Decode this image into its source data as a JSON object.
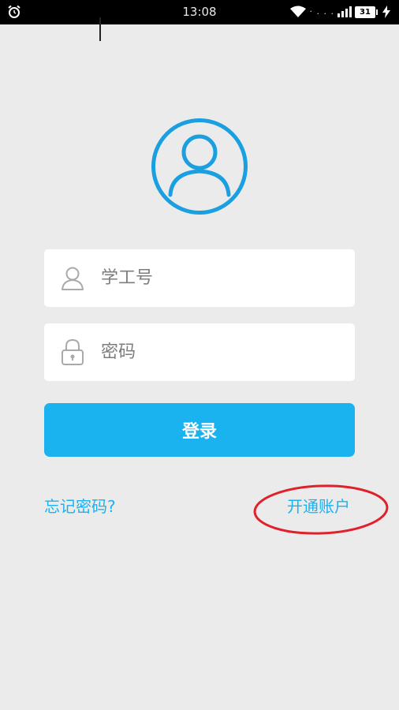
{
  "status_bar": {
    "time": "13:08",
    "battery": "31",
    "network_dots": "‧ . . ."
  },
  "login": {
    "username_placeholder": "学工号",
    "password_placeholder": "密码",
    "login_button": "登录",
    "forgot_password": "忘记密码?",
    "open_account": "开通账户"
  },
  "colors": {
    "accent": "#1ab2ef",
    "background": "#ebebeb",
    "annotation": "#e0202a"
  },
  "icons": {
    "avatar": "user-avatar-icon",
    "username": "user-icon",
    "password": "lock-icon"
  }
}
